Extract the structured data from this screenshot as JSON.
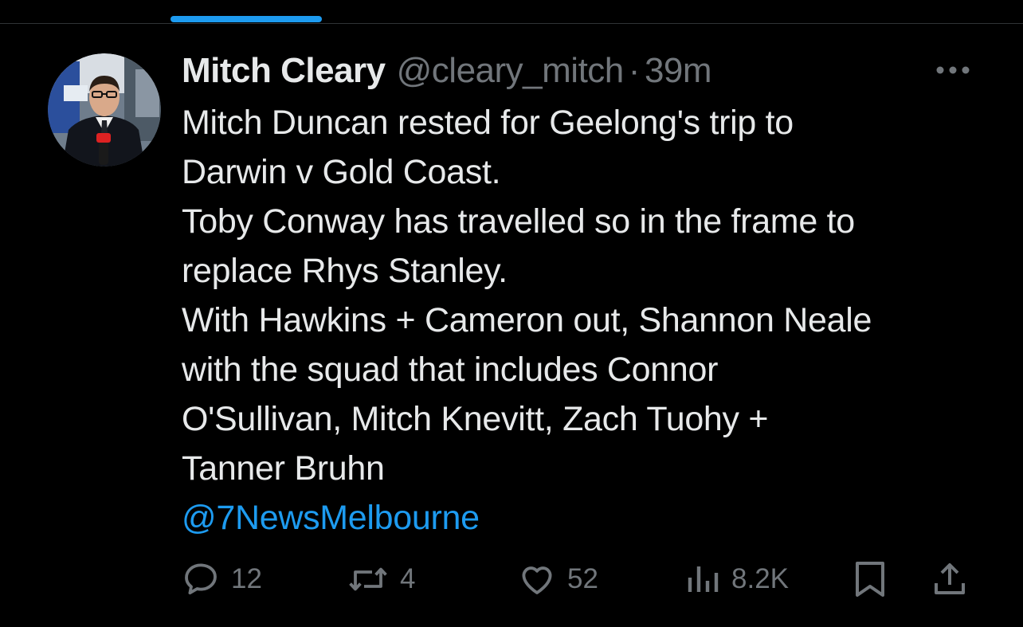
{
  "colors": {
    "background": "#000000",
    "text_primary": "#e7e9ea",
    "text_secondary": "#71767b",
    "accent": "#1d9bf0",
    "tab_indicator": "#1d9bf0"
  },
  "tweet": {
    "author": {
      "display_name": "Mitch Cleary",
      "handle": "@cleary_mitch",
      "avatar_icon": "avatar-photo"
    },
    "separator": "·",
    "time": "39m",
    "more_icon": "more-horizontal-icon",
    "lines": [
      "Mitch Duncan rested for Geelong's trip to",
      "Darwin v Gold Coast.",
      "Toby Conway has travelled so in the frame to",
      "replace Rhys Stanley.",
      "With Hawkins + Cameron out, Shannon Neale",
      "with the squad that includes Connor",
      "O'Sullivan, Mitch Knevitt, Zach Tuohy +",
      "Tanner Bruhn"
    ],
    "mention": "@7NewsMelbourne"
  },
  "actions": {
    "reply": {
      "icon": "reply-icon",
      "count": "12"
    },
    "retweet": {
      "icon": "retweet-icon",
      "count": "4"
    },
    "like": {
      "icon": "heart-icon",
      "count": "52"
    },
    "views": {
      "icon": "views-icon",
      "count": "8.2K"
    },
    "bookmark": {
      "icon": "bookmark-icon"
    },
    "share": {
      "icon": "share-icon"
    }
  }
}
